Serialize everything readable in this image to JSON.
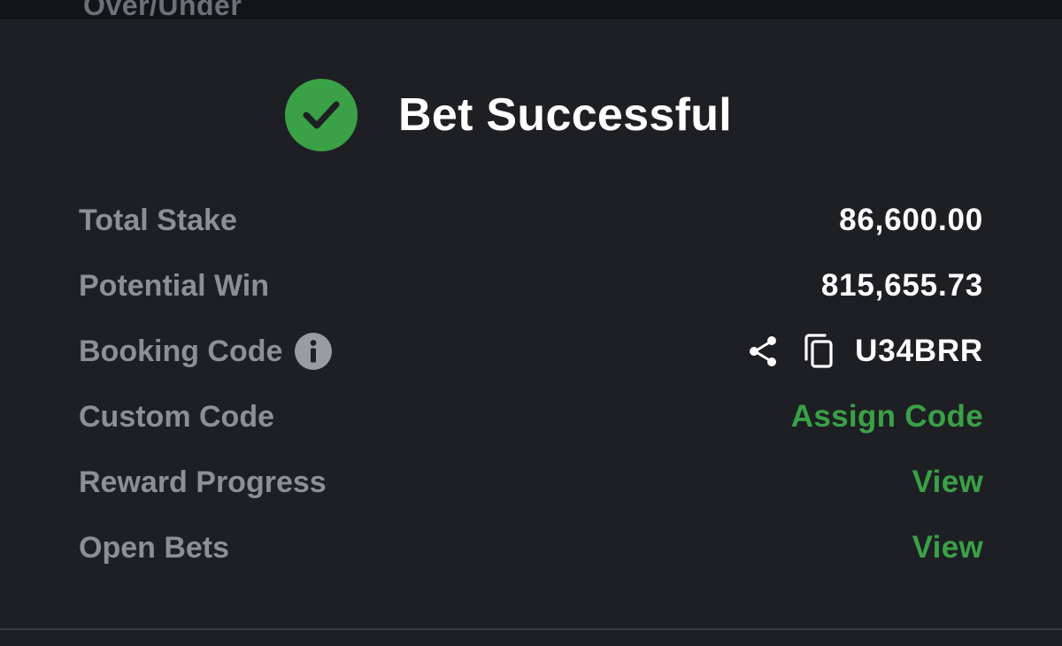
{
  "top_strip": {
    "label": "Over/Under"
  },
  "header": {
    "title": "Bet Successful",
    "status_icon": "check-circle-icon"
  },
  "rows": [
    {
      "label": "Total Stake",
      "value": "86,600.00"
    },
    {
      "label": "Potential Win",
      "value": "815,655.73"
    },
    {
      "label": "Booking Code",
      "value": "U34BRR",
      "label_icon": "info-icon",
      "actions": [
        "share-icon",
        "copy-icon"
      ]
    },
    {
      "label": "Custom Code",
      "value": "Assign Code"
    },
    {
      "label": "Reward Progress",
      "value": "View"
    },
    {
      "label": "Open Bets",
      "value": "View"
    }
  ],
  "colors": {
    "background": "#1e1f24",
    "accent_green": "#3aa146",
    "label_gray": "#8d8f98",
    "value_white": "#ffffff"
  }
}
